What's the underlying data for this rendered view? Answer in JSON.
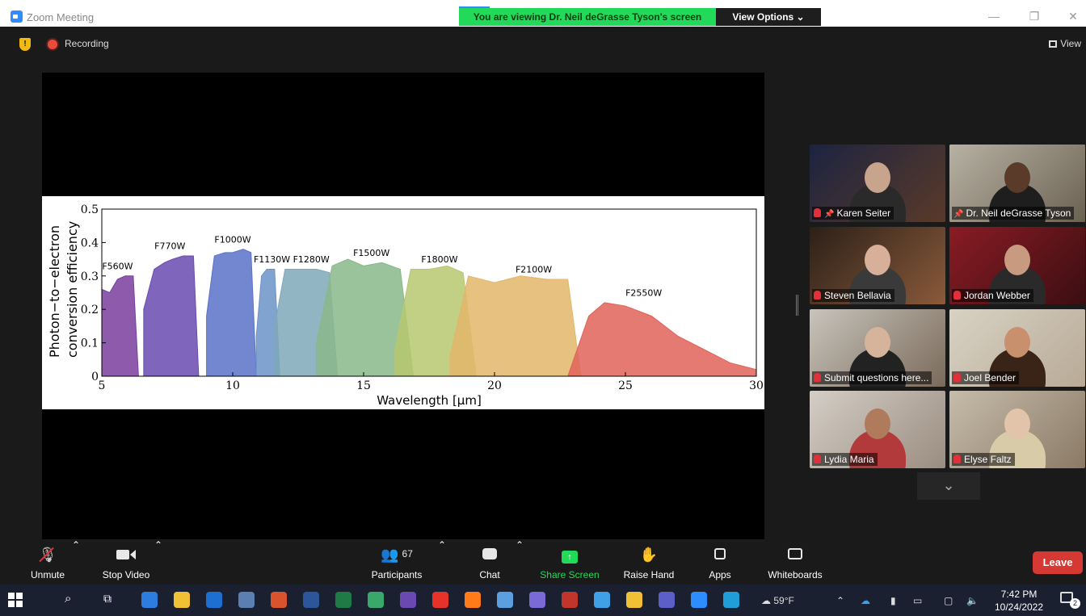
{
  "window": {
    "title": "Zoom Meeting",
    "share_banner": "You are viewing Dr. Neil deGrasse Tyson's screen",
    "view_options": "View Options ⌄"
  },
  "topbar": {
    "recording": "Recording",
    "view": "View"
  },
  "chart_data": {
    "type": "area",
    "xlabel": "Wavelength [μm]",
    "ylabel_line1": "Photon−to−electron",
    "ylabel_line2": "conversion efficiency",
    "xlim": [
      5,
      30
    ],
    "ylim": [
      0,
      0.5
    ],
    "xticks": [
      "5",
      "10",
      "15",
      "20",
      "25",
      "30"
    ],
    "yticks": [
      "0",
      "0.1",
      "0.2",
      "0.3",
      "0.4",
      "0.5"
    ],
    "grid": false,
    "series": [
      {
        "name": "F560W",
        "color": "#7a3e9e",
        "x": [
          5.0,
          5.3,
          5.6,
          5.9,
          6.2,
          6.4
        ],
        "y": [
          0.26,
          0.25,
          0.29,
          0.3,
          0.3,
          0.0
        ],
        "label_at": [
          5.6,
          0.32
        ]
      },
      {
        "name": "F770W",
        "color": "#6a4ab0",
        "x": [
          6.6,
          7.0,
          7.4,
          7.7,
          8.1,
          8.5,
          8.7
        ],
        "y": [
          0.2,
          0.32,
          0.34,
          0.35,
          0.36,
          0.36,
          0.0
        ],
        "label_at": [
          7.6,
          0.38
        ]
      },
      {
        "name": "F1000W",
        "color": "#5a72c8",
        "x": [
          9.0,
          9.3,
          9.7,
          10.0,
          10.4,
          10.7,
          10.9
        ],
        "y": [
          0.18,
          0.36,
          0.37,
          0.37,
          0.38,
          0.37,
          0.0
        ],
        "label_at": [
          10.0,
          0.4
        ]
      },
      {
        "name": "F1130W",
        "color": "#6b93c8",
        "x": [
          10.9,
          11.1,
          11.3,
          11.6,
          11.8
        ],
        "y": [
          0.12,
          0.3,
          0.32,
          0.32,
          0.0
        ],
        "label_at": [
          11.5,
          0.34
        ]
      },
      {
        "name": "F1280W",
        "color": "#7fa8b8",
        "x": [
          11.6,
          12.0,
          12.6,
          13.2,
          13.7,
          14.0
        ],
        "y": [
          0.15,
          0.32,
          0.32,
          0.32,
          0.31,
          0.0
        ],
        "label_at": [
          13.0,
          0.34
        ]
      },
      {
        "name": "F1500W",
        "color": "#8ab88a",
        "x": [
          13.2,
          13.8,
          14.4,
          15.0,
          15.7,
          16.4,
          16.9
        ],
        "y": [
          0.1,
          0.33,
          0.35,
          0.33,
          0.34,
          0.32,
          0.0
        ],
        "label_at": [
          15.3,
          0.36
        ]
      },
      {
        "name": "F1800W",
        "color": "#b6c870",
        "x": [
          16.2,
          16.8,
          17.5,
          18.2,
          18.8,
          19.3
        ],
        "y": [
          0.08,
          0.32,
          0.32,
          0.33,
          0.31,
          0.0
        ],
        "label_at": [
          17.9,
          0.34
        ]
      },
      {
        "name": "F2100W",
        "color": "#e3b66a",
        "x": [
          18.3,
          19.0,
          20.0,
          21.0,
          22.0,
          22.8,
          23.3
        ],
        "y": [
          0.06,
          0.3,
          0.28,
          0.3,
          0.29,
          0.29,
          0.0
        ],
        "label_at": [
          21.5,
          0.31
        ]
      },
      {
        "name": "F2550W",
        "color": "#e0635a",
        "x": [
          22.8,
          23.6,
          24.2,
          25.0,
          26.0,
          27.0,
          28.0,
          29.0,
          30.0
        ],
        "y": [
          0.0,
          0.18,
          0.22,
          0.21,
          0.18,
          0.12,
          0.08,
          0.04,
          0.02
        ],
        "label_at": [
          25.7,
          0.24
        ]
      }
    ]
  },
  "participants": [
    {
      "name": "Karen Seiter",
      "muted": true,
      "pinned": true,
      "bg": "#1c2340",
      "bg2": "#5a3a2a",
      "face": "#c9a48c",
      "body": "#2a2a2a"
    },
    {
      "name": "Dr. Neil deGrasse Tyson",
      "muted": false,
      "pinned": true,
      "active": true,
      "bg": "#b8b2a4",
      "bg2": "#6b6152",
      "face": "#5a3a28",
      "body": "#1e1e1e"
    },
    {
      "name": "Steven Bellavia",
      "muted": true,
      "pinned": false,
      "bg": "#2c2018",
      "bg2": "#8a5a3a",
      "face": "#d8b09a",
      "body": "#3a3a3a"
    },
    {
      "name": "Jordan Webber",
      "muted": true,
      "pinned": false,
      "bg": "#8a1c24",
      "bg2": "#3a0e12",
      "face": "#c89a80",
      "body": "#2a2a2a"
    },
    {
      "name": "Submit questions here...",
      "muted": true,
      "pinned": false,
      "bg": "#c8c4bc",
      "bg2": "#7a6a5a",
      "face": "#d6b49c",
      "body": "#222222"
    },
    {
      "name": "Joel Bender",
      "muted": true,
      "pinned": false,
      "bg": "#d8d2c4",
      "bg2": "#b8aa96",
      "face": "#c8906c",
      "body": "#3a2418"
    },
    {
      "name": "Lydia Maria",
      "muted": true,
      "pinned": false,
      "bg": "#d4cec6",
      "bg2": "#9a8c80",
      "face": "#b07a5c",
      "body": "#b23a3a"
    },
    {
      "name": "Elyse Faltz",
      "muted": true,
      "pinned": false,
      "bg": "#c6bcaa",
      "bg2": "#8a7a66",
      "face": "#e2c4aa",
      "body": "#d8cca8"
    }
  ],
  "toolbar": {
    "unmute": "Unmute",
    "stop_video": "Stop Video",
    "participants": "Participants",
    "participant_count": "67",
    "chat": "Chat",
    "share_screen": "Share Screen",
    "raise_hand": "Raise Hand",
    "apps": "Apps",
    "whiteboards": "Whiteboards",
    "leave": "Leave"
  },
  "taskbar": {
    "weather": "59°F",
    "time": "7:42 PM",
    "date": "10/24/2022",
    "notifications": "2",
    "app_colors": [
      "#2d7de0",
      "#f2c037",
      "#1d6fd1",
      "#5a7fb0",
      "#d9532c",
      "#2b579a",
      "#1f7a45",
      "#3aa86a",
      "#6a4ab0",
      "#e5332a",
      "#ff7b1a",
      "#5aa0e0",
      "#7a6ad8",
      "#c2352a",
      "#3fa0e8",
      "#f2c037",
      "#5b5fc7",
      "#2d8cff",
      "#1f9ed8"
    ]
  }
}
